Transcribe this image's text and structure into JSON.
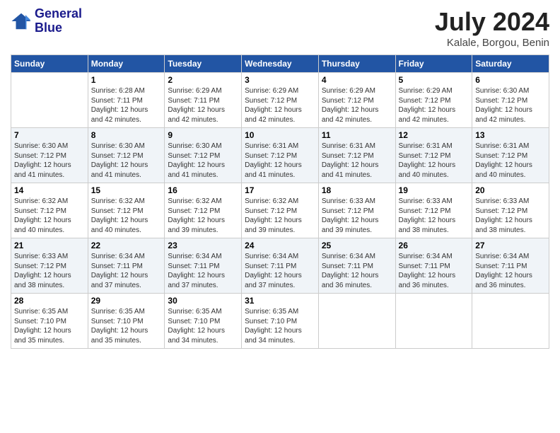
{
  "header": {
    "logo_line1": "General",
    "logo_line2": "Blue",
    "month_title": "July 2024",
    "location": "Kalale, Borgou, Benin"
  },
  "days_of_week": [
    "Sunday",
    "Monday",
    "Tuesday",
    "Wednesday",
    "Thursday",
    "Friday",
    "Saturday"
  ],
  "weeks": [
    [
      {
        "day": "",
        "sunrise": "",
        "sunset": "",
        "daylight": ""
      },
      {
        "day": "1",
        "sunrise": "6:28 AM",
        "sunset": "7:11 PM",
        "daylight": "12 hours and 42 minutes."
      },
      {
        "day": "2",
        "sunrise": "6:29 AM",
        "sunset": "7:11 PM",
        "daylight": "12 hours and 42 minutes."
      },
      {
        "day": "3",
        "sunrise": "6:29 AM",
        "sunset": "7:12 PM",
        "daylight": "12 hours and 42 minutes."
      },
      {
        "day": "4",
        "sunrise": "6:29 AM",
        "sunset": "7:12 PM",
        "daylight": "12 hours and 42 minutes."
      },
      {
        "day": "5",
        "sunrise": "6:29 AM",
        "sunset": "7:12 PM",
        "daylight": "12 hours and 42 minutes."
      },
      {
        "day": "6",
        "sunrise": "6:30 AM",
        "sunset": "7:12 PM",
        "daylight": "12 hours and 42 minutes."
      }
    ],
    [
      {
        "day": "7",
        "sunrise": "6:30 AM",
        "sunset": "7:12 PM",
        "daylight": "12 hours and 41 minutes."
      },
      {
        "day": "8",
        "sunrise": "6:30 AM",
        "sunset": "7:12 PM",
        "daylight": "12 hours and 41 minutes."
      },
      {
        "day": "9",
        "sunrise": "6:30 AM",
        "sunset": "7:12 PM",
        "daylight": "12 hours and 41 minutes."
      },
      {
        "day": "10",
        "sunrise": "6:31 AM",
        "sunset": "7:12 PM",
        "daylight": "12 hours and 41 minutes."
      },
      {
        "day": "11",
        "sunrise": "6:31 AM",
        "sunset": "7:12 PM",
        "daylight": "12 hours and 41 minutes."
      },
      {
        "day": "12",
        "sunrise": "6:31 AM",
        "sunset": "7:12 PM",
        "daylight": "12 hours and 40 minutes."
      },
      {
        "day": "13",
        "sunrise": "6:31 AM",
        "sunset": "7:12 PM",
        "daylight": "12 hours and 40 minutes."
      }
    ],
    [
      {
        "day": "14",
        "sunrise": "6:32 AM",
        "sunset": "7:12 PM",
        "daylight": "12 hours and 40 minutes."
      },
      {
        "day": "15",
        "sunrise": "6:32 AM",
        "sunset": "7:12 PM",
        "daylight": "12 hours and 40 minutes."
      },
      {
        "day": "16",
        "sunrise": "6:32 AM",
        "sunset": "7:12 PM",
        "daylight": "12 hours and 39 minutes."
      },
      {
        "day": "17",
        "sunrise": "6:32 AM",
        "sunset": "7:12 PM",
        "daylight": "12 hours and 39 minutes."
      },
      {
        "day": "18",
        "sunrise": "6:33 AM",
        "sunset": "7:12 PM",
        "daylight": "12 hours and 39 minutes."
      },
      {
        "day": "19",
        "sunrise": "6:33 AM",
        "sunset": "7:12 PM",
        "daylight": "12 hours and 38 minutes."
      },
      {
        "day": "20",
        "sunrise": "6:33 AM",
        "sunset": "7:12 PM",
        "daylight": "12 hours and 38 minutes."
      }
    ],
    [
      {
        "day": "21",
        "sunrise": "6:33 AM",
        "sunset": "7:12 PM",
        "daylight": "12 hours and 38 minutes."
      },
      {
        "day": "22",
        "sunrise": "6:34 AM",
        "sunset": "7:11 PM",
        "daylight": "12 hours and 37 minutes."
      },
      {
        "day": "23",
        "sunrise": "6:34 AM",
        "sunset": "7:11 PM",
        "daylight": "12 hours and 37 minutes."
      },
      {
        "day": "24",
        "sunrise": "6:34 AM",
        "sunset": "7:11 PM",
        "daylight": "12 hours and 37 minutes."
      },
      {
        "day": "25",
        "sunrise": "6:34 AM",
        "sunset": "7:11 PM",
        "daylight": "12 hours and 36 minutes."
      },
      {
        "day": "26",
        "sunrise": "6:34 AM",
        "sunset": "7:11 PM",
        "daylight": "12 hours and 36 minutes."
      },
      {
        "day": "27",
        "sunrise": "6:34 AM",
        "sunset": "7:11 PM",
        "daylight": "12 hours and 36 minutes."
      }
    ],
    [
      {
        "day": "28",
        "sunrise": "6:35 AM",
        "sunset": "7:10 PM",
        "daylight": "12 hours and 35 minutes."
      },
      {
        "day": "29",
        "sunrise": "6:35 AM",
        "sunset": "7:10 PM",
        "daylight": "12 hours and 35 minutes."
      },
      {
        "day": "30",
        "sunrise": "6:35 AM",
        "sunset": "7:10 PM",
        "daylight": "12 hours and 34 minutes."
      },
      {
        "day": "31",
        "sunrise": "6:35 AM",
        "sunset": "7:10 PM",
        "daylight": "12 hours and 34 minutes."
      },
      {
        "day": "",
        "sunrise": "",
        "sunset": "",
        "daylight": ""
      },
      {
        "day": "",
        "sunrise": "",
        "sunset": "",
        "daylight": ""
      },
      {
        "day": "",
        "sunrise": "",
        "sunset": "",
        "daylight": ""
      }
    ]
  ],
  "labels": {
    "sunrise_prefix": "Sunrise: ",
    "sunset_prefix": "Sunset: ",
    "daylight_prefix": "Daylight: "
  }
}
